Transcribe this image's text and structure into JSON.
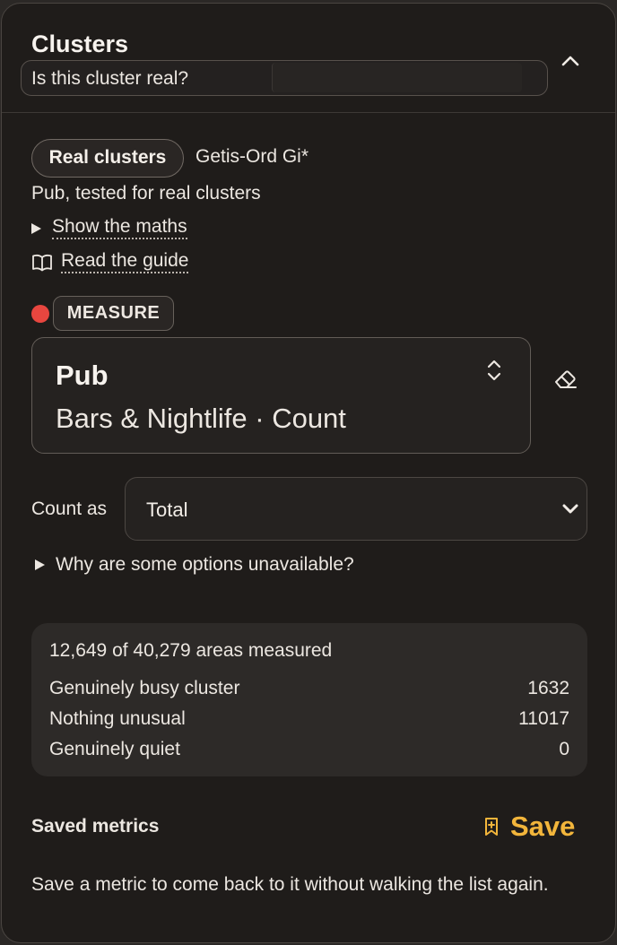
{
  "header": {
    "title": "Clusters",
    "question": "Is this cluster real?"
  },
  "method": {
    "pill_label": "Real clusters",
    "name": "Getis-Ord Gi*",
    "subtitle": "Pub, tested for real clusters",
    "show_maths": "Show the maths",
    "read_guide": "Read the guide"
  },
  "measure": {
    "tag": "MEASURE",
    "dot_color": "#e8463f",
    "metric_name": "Pub",
    "metric_sub": "Bars & Nightlife · Count"
  },
  "count_as": {
    "label": "Count as",
    "selected": "Total"
  },
  "why_unavailable": "Why are some options unavailable?",
  "stats": {
    "headline": "12,649 of 40,279 areas measured",
    "rows": [
      {
        "label": "Genuinely busy cluster",
        "value": "1632"
      },
      {
        "label": "Nothing unusual",
        "value": "11017"
      },
      {
        "label": "Genuinely quiet",
        "value": "0"
      }
    ]
  },
  "saved": {
    "label": "Saved metrics",
    "save_button": "Save",
    "accent": "#f2b53b",
    "note": "Save a metric to come back to it without walking the list again."
  }
}
